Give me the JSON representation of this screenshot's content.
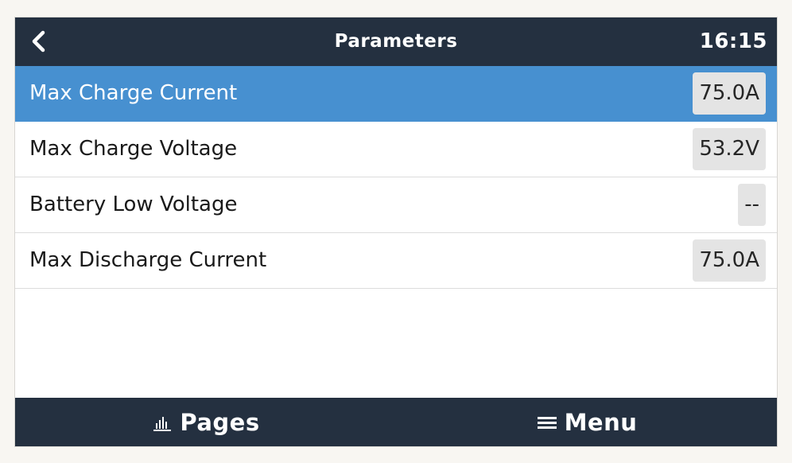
{
  "header": {
    "title": "Parameters",
    "time": "16:15",
    "back_icon": "chevron-left-icon"
  },
  "parameters": [
    {
      "label": "Max Charge Current",
      "value": "75.0A",
      "selected": true
    },
    {
      "label": "Max Charge Voltage",
      "value": "53.2V",
      "selected": false
    },
    {
      "label": "Battery Low Voltage",
      "value": "--",
      "selected": false
    },
    {
      "label": "Max Discharge Current",
      "value": "75.0A",
      "selected": false
    }
  ],
  "footer": {
    "pages_label": "Pages",
    "pages_icon": "bar-chart-icon",
    "menu_label": "Menu",
    "menu_icon": "hamburger-menu-icon"
  },
  "colors": {
    "header_bg": "#243040",
    "selected_row": "#4790d0",
    "value_box": "#e4e4e4"
  }
}
